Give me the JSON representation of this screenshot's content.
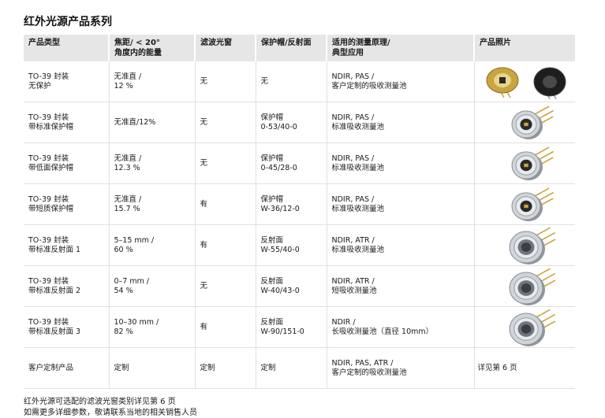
{
  "title": "红外光源产品系列",
  "headers": [
    "产品类型",
    "焦距/ < 20°\n角度内的能量",
    "滤波光窗",
    "保护帽/反射面",
    "适用的测量原理/\n典型应用",
    "产品照片"
  ],
  "rows": [
    {
      "type": [
        "TO-39 封装",
        "无保护"
      ],
      "focus": [
        "无准直 /",
        "12 %"
      ],
      "filter": "无",
      "cap": [
        "无"
      ],
      "app": [
        "NDIR, PAS /",
        "客户定制的吸收测量池"
      ],
      "photo": "two-open-to39-sources-image"
    },
    {
      "type": [
        "TO-39 封装",
        "带标准保护帽"
      ],
      "focus": [
        "无准直/12%"
      ],
      "filter": "无",
      "cap": [
        "保护帽",
        "0-53/40-0"
      ],
      "app": [
        "NDIR, PAS /",
        "标准吸收测量池"
      ],
      "photo": "capped-to39-source-image"
    },
    {
      "type": [
        "TO-39 封装",
        "带低面保护帽"
      ],
      "focus": [
        "无准直 /",
        "12.3 %"
      ],
      "filter": "无",
      "cap": [
        "保护帽",
        "0-45/28-0"
      ],
      "app": [
        "NDIR, PAS /",
        "标准吸收测量池"
      ],
      "photo": "low-cap-to39-source-image"
    },
    {
      "type": [
        "TO-39 封装",
        "带短质保护帽"
      ],
      "focus": [
        "无准直 /",
        "15.7 %"
      ],
      "filter": "有",
      "cap": [
        "保护帽",
        "W-36/12-0"
      ],
      "app": [
        "NDIR, PAS /",
        "标准吸收测量池"
      ],
      "photo": "short-cap-to39-source-image"
    },
    {
      "type": [
        "TO-39 封装",
        "带标准反射面 1"
      ],
      "focus": [
        "5–15 mm /",
        "60 %"
      ],
      "filter": "有",
      "cap": [
        "反射面",
        "W-55/40-0"
      ],
      "app": [
        "NDIR, ATR /",
        "标准吸收测量池"
      ],
      "photo": "reflector-1-source-image"
    },
    {
      "type": [
        "TO-39 封装",
        "带标准反射面 2"
      ],
      "focus": [
        "0–7 mm /",
        "54 %"
      ],
      "filter": "无",
      "cap": [
        "反射面",
        "W-40/43-0"
      ],
      "app": [
        "NDIR, ATR /",
        "短吸收测量池"
      ],
      "photo": "reflector-2-source-image"
    },
    {
      "type": [
        "TO-39 封装",
        "带标准反射面 3"
      ],
      "focus": [
        "10–30 mm /",
        "82 %"
      ],
      "filter": "有",
      "cap": [
        "反射面",
        "W-90/151-0"
      ],
      "app": [
        "NDIR /",
        "长吸收测量池（直径 10mm）"
      ],
      "photo": "reflector-3-source-image"
    },
    {
      "type": [
        "客户定制产品"
      ],
      "focus": [
        "定制"
      ],
      "filter": "定制",
      "cap": [
        "定制"
      ],
      "app": [
        "NDIR, PAS, ATR /",
        "客户定制的吸收测量池"
      ],
      "photo_text": "详见第 6 页"
    }
  ],
  "notes": [
    "红外光源可选配的滤波光窗类别详见第 6 页",
    "如需更多详细参数，敬请联系当地的相关销售人员"
  ],
  "colors": {
    "header_bg": "#e6e6e6",
    "gold": "#c9a441",
    "black_body": "#1e1e1e",
    "metal": "#b9bec4"
  }
}
